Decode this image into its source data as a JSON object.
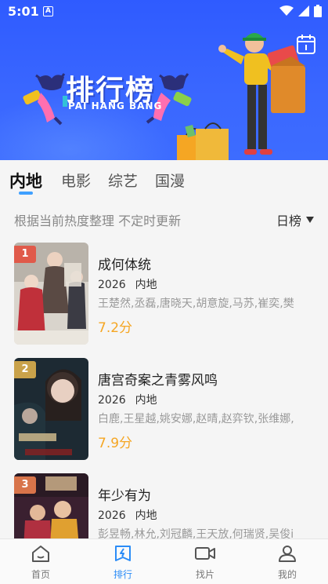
{
  "status_bar": {
    "time": "5:01",
    "notification_badge": "A",
    "icons": [
      "wifi-icon",
      "signal-icon",
      "battery-icon"
    ]
  },
  "hero": {
    "title": "排行榜",
    "subtitle": "PAI HANG BANG",
    "calendar_icon": "calendar-icon"
  },
  "tabs": [
    {
      "label": "内地",
      "active": true
    },
    {
      "label": "电影",
      "active": false
    },
    {
      "label": "综艺",
      "active": false
    },
    {
      "label": "国漫",
      "active": false
    }
  ],
  "filter": {
    "description": "根据当前热度整理 不定时更新",
    "selected": "日榜"
  },
  "items": [
    {
      "rank": "1",
      "title": "成何体统",
      "year": "2026",
      "region": "内地",
      "cast": "王楚然,丞磊,唐晓天,胡意旋,马苏,崔奕,樊",
      "score": "7.2分"
    },
    {
      "rank": "2",
      "title": "唐宫奇案之青雾风鸣",
      "year": "2026",
      "region": "内地",
      "cast": "白鹿,王星越,姚安娜,赵晴,赵弈钦,张维娜,",
      "score": "7.9分"
    },
    {
      "rank": "3",
      "title": "年少有为",
      "year": "2026",
      "region": "内地",
      "cast": "彭昱畅,林允,刘冠麟,王天放,何瑞贤,吴俊i",
      "score": ""
    }
  ],
  "colors": {
    "accent": "#2b8cf7",
    "hero_bg": "#3a67ff",
    "score": "#f5a623",
    "rank1": "#e05a4a",
    "rank2": "#c9a24a",
    "rank3": "#d8744a"
  },
  "bottom_nav": [
    {
      "label": "首页",
      "icon": "home-icon",
      "active": false
    },
    {
      "label": "排行",
      "icon": "ranking-icon",
      "active": true
    },
    {
      "label": "找片",
      "icon": "video-camera-icon",
      "active": false
    },
    {
      "label": "我的",
      "icon": "user-icon",
      "active": false
    }
  ]
}
